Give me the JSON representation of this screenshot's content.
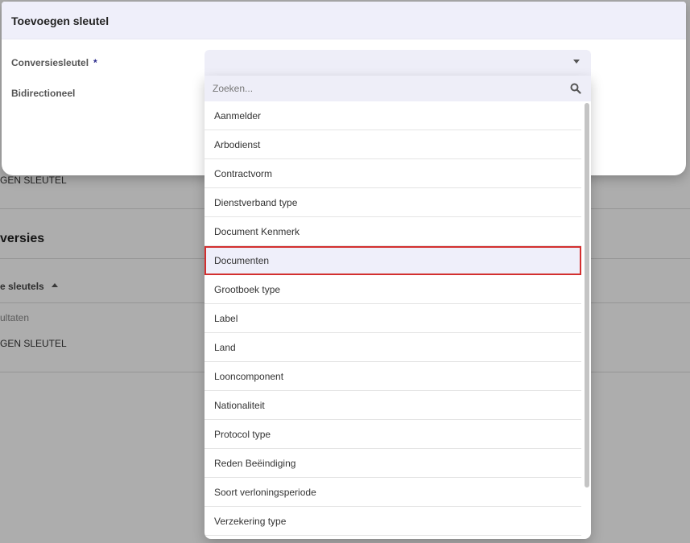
{
  "background": {
    "row_button_1": "GEN SLEUTEL",
    "section_title": "versies",
    "column_header": "e sleutels",
    "sort_icon": "sort-up-icon",
    "results_label": "ultaten",
    "row_button_2": "GEN SLEUTEL"
  },
  "dialog": {
    "title": "Toevoegen sleutel",
    "fields": {
      "conversion_key_label": "Conversiesleutel",
      "required_marker": "*",
      "bidirectional_label": "Bidirectioneel"
    }
  },
  "dropdown": {
    "search_placeholder": "Zoeken...",
    "search_value": "",
    "selected_index": 5,
    "options": [
      "Aanmelder",
      "Arbodienst",
      "Contractvorm",
      "Dienstverband type",
      "Document Kenmerk",
      "Documenten",
      "Grootboek type",
      "Label",
      "Land",
      "Looncomponent",
      "Nationaliteit",
      "Protocol type",
      "Reden Beëindiging",
      "Soort verloningsperiode",
      "Verzekering type"
    ]
  },
  "colors": {
    "header_bg": "#efeffa",
    "selected_border": "#d32f2f",
    "required": "#2a2a8c"
  }
}
